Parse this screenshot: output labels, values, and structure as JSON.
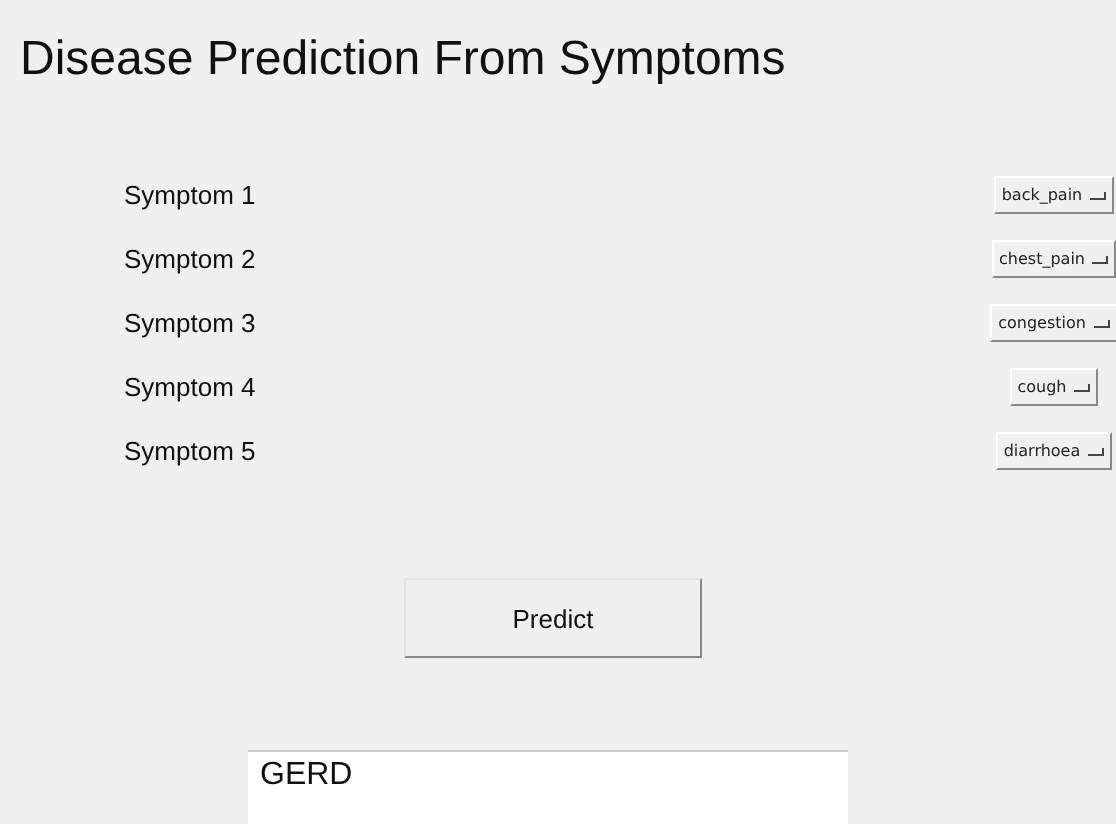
{
  "title": "Disease Prediction From Symptoms",
  "symptoms": [
    {
      "label": "Symptom 1",
      "value": "back_pain"
    },
    {
      "label": "Symptom 2",
      "value": "chest_pain"
    },
    {
      "label": "Symptom 3",
      "value": "congestion"
    },
    {
      "label": "Symptom 4",
      "value": "cough"
    },
    {
      "label": "Symptom 5",
      "value": "diarrhoea"
    }
  ],
  "predict_button": "Predict",
  "result": "GERD"
}
